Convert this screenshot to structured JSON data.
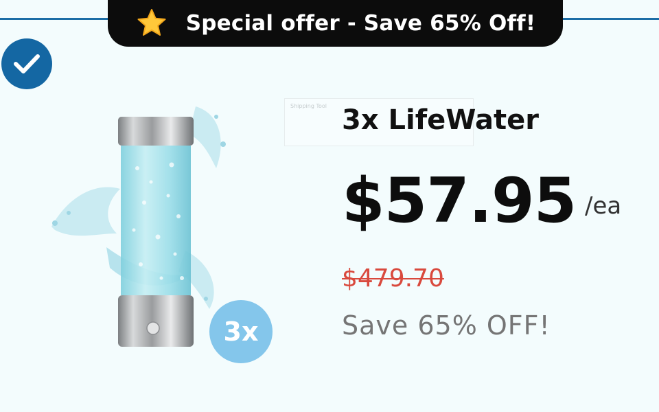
{
  "banner": {
    "text": "Special offer - Save 65% Off!",
    "icon": "star-icon"
  },
  "selection": {
    "icon": "checkmark-icon",
    "selected": true
  },
  "product": {
    "image": "hydrogen-water-bottle-image",
    "quantity_badge": "3x",
    "title": "3x LifeWater",
    "price": "$57.95",
    "per_unit": "/ea",
    "original_price": "$479.70",
    "savings": "Save 65% OFF!"
  },
  "ghost_box": {
    "text": "Shipping Tool"
  },
  "colors": {
    "accent_blue": "#1467a3",
    "badge_blue": "#84c6eb",
    "strike_red": "#d9493d",
    "background": "#f3fcfd"
  }
}
